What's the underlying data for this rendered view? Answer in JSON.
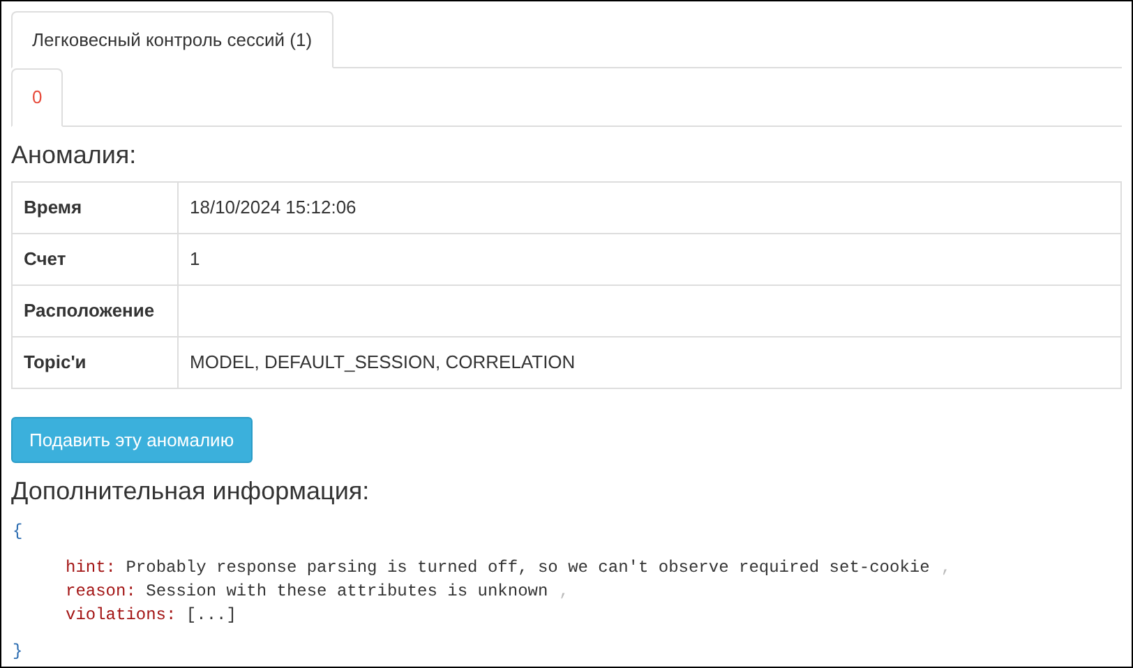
{
  "tabs": [
    {
      "label": "Легковесный контроль сессий (1)",
      "selected": true
    }
  ],
  "subtabs": [
    {
      "label": "0",
      "selected": true
    }
  ],
  "anomaly_heading": "Аномалия:",
  "table": {
    "rows": [
      {
        "label": "Время",
        "value": "18/10/2024 15:12:06"
      },
      {
        "label": "Счет",
        "value": "1"
      },
      {
        "label": "Расположение"
      },
      {
        "label": "Topic'и",
        "value": "MODEL, DEFAULT_SESSION, CORRELATION"
      }
    ]
  },
  "submit_button": "Подавить эту аномалию",
  "info_heading": "Дополнительная информация:",
  "details": {
    "open_brace": "{",
    "close_brace": "}",
    "entries": [
      {
        "key": "hint:",
        "value": "Probably response parsing is turned off, so we can't observe required set-cookie",
        "comma": ","
      },
      {
        "key": "reason:",
        "value": "Session with these attributes is unknown",
        "comma": ","
      },
      {
        "key": "violations:",
        "value": "[...]"
      }
    ]
  }
}
